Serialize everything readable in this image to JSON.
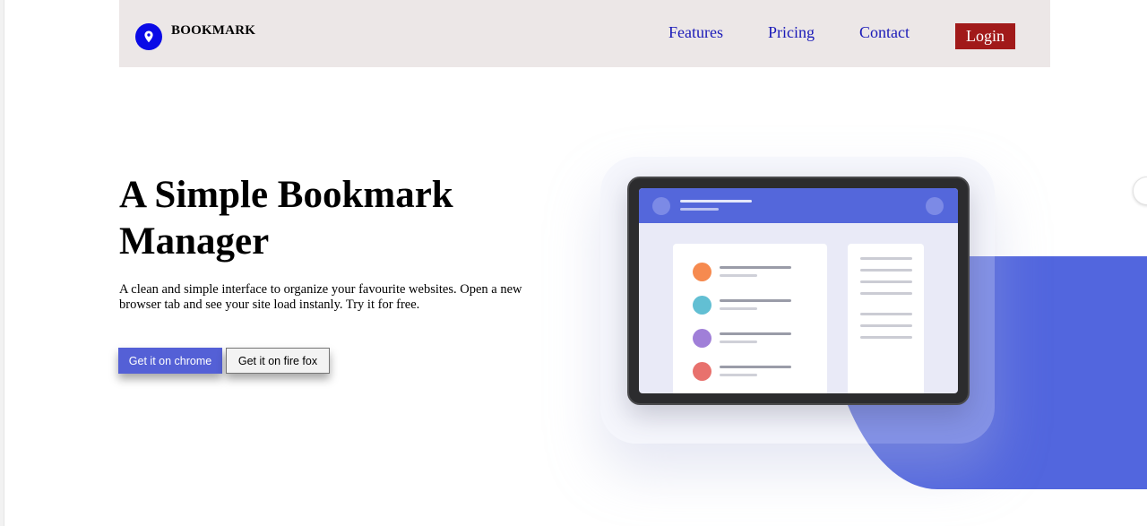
{
  "brand": {
    "name": "BOOKMARK",
    "icon": "location-pin-icon",
    "color": "#0a0ae6"
  },
  "nav": {
    "links": [
      {
        "label": "Features"
      },
      {
        "label": "Pricing"
      },
      {
        "label": "Contact"
      }
    ],
    "login_label": "Login",
    "link_color": "#1a1ab8",
    "login_color": "#a11a1a"
  },
  "hero": {
    "title": "A Simple Bookmark Manager",
    "description": "A clean and simple interface to organize your favourite websites. Open a new browser tab and see your site load instanly. Try it for free.",
    "buttons": {
      "chrome": "Get it on chrome",
      "firefox": "Get it on fire fox"
    },
    "accent_color": "#5266de"
  },
  "illustration": {
    "bookmark_dot_colors": [
      "#f68a4f",
      "#62bfd3",
      "#a07fd8",
      "#e8716d"
    ]
  }
}
